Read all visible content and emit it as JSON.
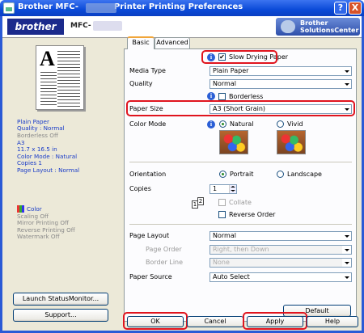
{
  "window": {
    "title_prefix": "Brother MFC-",
    "title_suffix": "Printer Printing Preferences",
    "help_button": "?",
    "close_button": "X"
  },
  "header": {
    "logo": "brother",
    "model_prefix": "MFC-",
    "solutions_center": "Brother SolutionsCenter"
  },
  "summary": {
    "lines_blue": [
      "Plain Paper",
      "Quality : Normal"
    ],
    "line_gray1": "Borderless Off",
    "lines_blue2": [
      "A3",
      "11.7 x 16.5 in",
      "Color Mode : Natural",
      "Copies 1",
      "Page Layout : Normal"
    ],
    "color_label": "Color",
    "lines_gray2": [
      "Scaling Off",
      "Mirror Printing Off",
      "Reverse Printing Off",
      "Watermark Off"
    ]
  },
  "left_buttons": {
    "launch": "Launch StatusMonitor...",
    "support": "Support..."
  },
  "tabs": [
    "Basic",
    "Advanced"
  ],
  "basic": {
    "slow_drying": "Slow Drying Paper",
    "media_type_label": "Media Type",
    "media_type_value": "Plain Paper",
    "quality_label": "Quality",
    "quality_value": "Normal",
    "borderless": "Borderless",
    "paper_size_label": "Paper Size",
    "paper_size_value": "A3 (Short Grain)",
    "color_mode_label": "Color Mode",
    "natural": "Natural",
    "vivid": "Vivid",
    "orientation_label": "Orientation",
    "portrait": "Portrait",
    "landscape": "Landscape",
    "copies_label": "Copies",
    "copies_value": "1",
    "collate": "Collate",
    "reverse_order": "Reverse Order",
    "page_layout_label": "Page Layout",
    "page_layout_value": "Normal",
    "page_order_label": "Page Order",
    "page_order_value": "Right, then Down",
    "border_line_label": "Border Line",
    "border_line_value": "None",
    "paper_source_label": "Paper Source",
    "paper_source_value": "Auto Select",
    "default_button": "Default"
  },
  "bottom_buttons": {
    "ok": "OK",
    "cancel": "Cancel",
    "apply": "Apply",
    "help": "Help"
  },
  "colors": {
    "highlight": "#e0141e",
    "title_bar": "#0b4ad8",
    "summary_blue": "#1a3cc8"
  }
}
